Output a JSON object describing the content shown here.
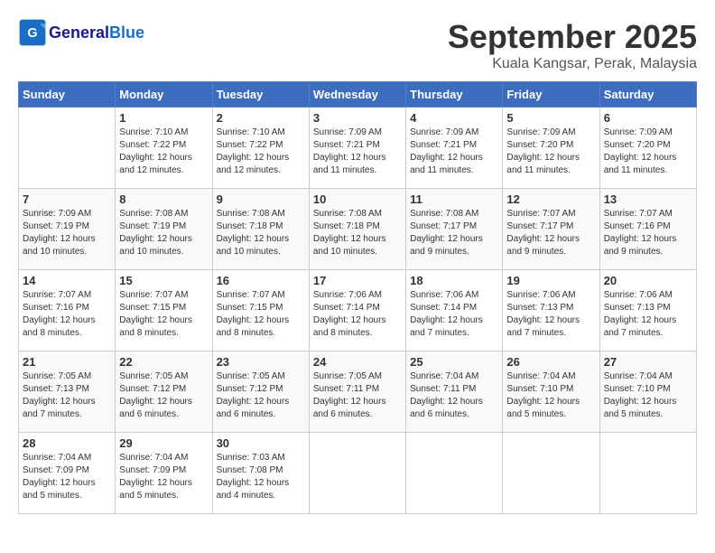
{
  "header": {
    "logo_general": "General",
    "logo_blue": "Blue",
    "month": "September 2025",
    "location": "Kuala Kangsar, Perak, Malaysia"
  },
  "days_of_week": [
    "Sunday",
    "Monday",
    "Tuesday",
    "Wednesday",
    "Thursday",
    "Friday",
    "Saturday"
  ],
  "weeks": [
    [
      {
        "day": "",
        "info": ""
      },
      {
        "day": "1",
        "info": "Sunrise: 7:10 AM\nSunset: 7:22 PM\nDaylight: 12 hours\nand 12 minutes."
      },
      {
        "day": "2",
        "info": "Sunrise: 7:10 AM\nSunset: 7:22 PM\nDaylight: 12 hours\nand 12 minutes."
      },
      {
        "day": "3",
        "info": "Sunrise: 7:09 AM\nSunset: 7:21 PM\nDaylight: 12 hours\nand 11 minutes."
      },
      {
        "day": "4",
        "info": "Sunrise: 7:09 AM\nSunset: 7:21 PM\nDaylight: 12 hours\nand 11 minutes."
      },
      {
        "day": "5",
        "info": "Sunrise: 7:09 AM\nSunset: 7:20 PM\nDaylight: 12 hours\nand 11 minutes."
      },
      {
        "day": "6",
        "info": "Sunrise: 7:09 AM\nSunset: 7:20 PM\nDaylight: 12 hours\nand 11 minutes."
      }
    ],
    [
      {
        "day": "7",
        "info": "Sunrise: 7:09 AM\nSunset: 7:19 PM\nDaylight: 12 hours\nand 10 minutes."
      },
      {
        "day": "8",
        "info": "Sunrise: 7:08 AM\nSunset: 7:19 PM\nDaylight: 12 hours\nand 10 minutes."
      },
      {
        "day": "9",
        "info": "Sunrise: 7:08 AM\nSunset: 7:18 PM\nDaylight: 12 hours\nand 10 minutes."
      },
      {
        "day": "10",
        "info": "Sunrise: 7:08 AM\nSunset: 7:18 PM\nDaylight: 12 hours\nand 10 minutes."
      },
      {
        "day": "11",
        "info": "Sunrise: 7:08 AM\nSunset: 7:17 PM\nDaylight: 12 hours\nand 9 minutes."
      },
      {
        "day": "12",
        "info": "Sunrise: 7:07 AM\nSunset: 7:17 PM\nDaylight: 12 hours\nand 9 minutes."
      },
      {
        "day": "13",
        "info": "Sunrise: 7:07 AM\nSunset: 7:16 PM\nDaylight: 12 hours\nand 9 minutes."
      }
    ],
    [
      {
        "day": "14",
        "info": "Sunrise: 7:07 AM\nSunset: 7:16 PM\nDaylight: 12 hours\nand 8 minutes."
      },
      {
        "day": "15",
        "info": "Sunrise: 7:07 AM\nSunset: 7:15 PM\nDaylight: 12 hours\nand 8 minutes."
      },
      {
        "day": "16",
        "info": "Sunrise: 7:07 AM\nSunset: 7:15 PM\nDaylight: 12 hours\nand 8 minutes."
      },
      {
        "day": "17",
        "info": "Sunrise: 7:06 AM\nSunset: 7:14 PM\nDaylight: 12 hours\nand 8 minutes."
      },
      {
        "day": "18",
        "info": "Sunrise: 7:06 AM\nSunset: 7:14 PM\nDaylight: 12 hours\nand 7 minutes."
      },
      {
        "day": "19",
        "info": "Sunrise: 7:06 AM\nSunset: 7:13 PM\nDaylight: 12 hours\nand 7 minutes."
      },
      {
        "day": "20",
        "info": "Sunrise: 7:06 AM\nSunset: 7:13 PM\nDaylight: 12 hours\nand 7 minutes."
      }
    ],
    [
      {
        "day": "21",
        "info": "Sunrise: 7:05 AM\nSunset: 7:13 PM\nDaylight: 12 hours\nand 7 minutes."
      },
      {
        "day": "22",
        "info": "Sunrise: 7:05 AM\nSunset: 7:12 PM\nDaylight: 12 hours\nand 6 minutes."
      },
      {
        "day": "23",
        "info": "Sunrise: 7:05 AM\nSunset: 7:12 PM\nDaylight: 12 hours\nand 6 minutes."
      },
      {
        "day": "24",
        "info": "Sunrise: 7:05 AM\nSunset: 7:11 PM\nDaylight: 12 hours\nand 6 minutes."
      },
      {
        "day": "25",
        "info": "Sunrise: 7:04 AM\nSunset: 7:11 PM\nDaylight: 12 hours\nand 6 minutes."
      },
      {
        "day": "26",
        "info": "Sunrise: 7:04 AM\nSunset: 7:10 PM\nDaylight: 12 hours\nand 5 minutes."
      },
      {
        "day": "27",
        "info": "Sunrise: 7:04 AM\nSunset: 7:10 PM\nDaylight: 12 hours\nand 5 minutes."
      }
    ],
    [
      {
        "day": "28",
        "info": "Sunrise: 7:04 AM\nSunset: 7:09 PM\nDaylight: 12 hours\nand 5 minutes."
      },
      {
        "day": "29",
        "info": "Sunrise: 7:04 AM\nSunset: 7:09 PM\nDaylight: 12 hours\nand 5 minutes."
      },
      {
        "day": "30",
        "info": "Sunrise: 7:03 AM\nSunset: 7:08 PM\nDaylight: 12 hours\nand 4 minutes."
      },
      {
        "day": "",
        "info": ""
      },
      {
        "day": "",
        "info": ""
      },
      {
        "day": "",
        "info": ""
      },
      {
        "day": "",
        "info": ""
      }
    ]
  ]
}
